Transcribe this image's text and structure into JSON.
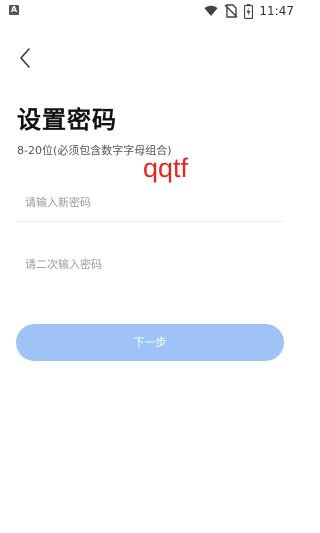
{
  "status_bar": {
    "time": "11:47",
    "notification_icon": "a-box-icon",
    "icons": [
      "wifi-icon",
      "no-sim-icon",
      "battery-charging-icon"
    ]
  },
  "header": {
    "back_icon": "chevron-left-icon"
  },
  "page": {
    "title": "设置密码",
    "subtitle": "8-20位(必须包含数字字母组合)",
    "watermark": "qqtf"
  },
  "form": {
    "new_password_placeholder": "请输入新密码",
    "confirm_password_placeholder": "请二次输入密码",
    "new_password_value": "",
    "confirm_password_value": ""
  },
  "actions": {
    "next_label": "下一步"
  },
  "colors": {
    "primary_button": "#9fc3f7",
    "watermark": "#e02828"
  }
}
